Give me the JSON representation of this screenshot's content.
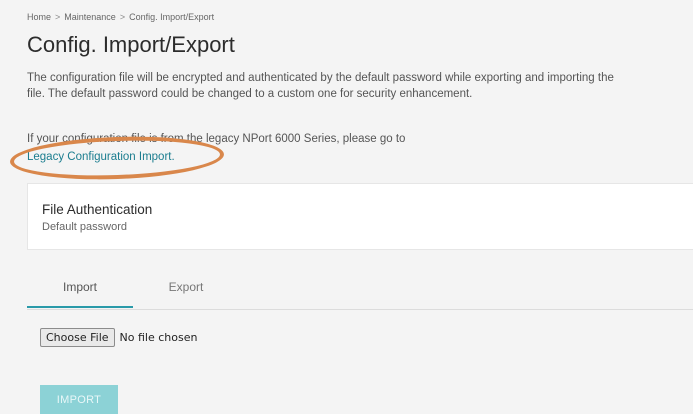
{
  "breadcrumb": {
    "items": [
      "Home",
      "Maintenance",
      "Config. Import/Export"
    ],
    "separator": ">"
  },
  "page": {
    "title": "Config. Import/Export",
    "description": "The configuration file will be encrypted and authenticated by the default password while exporting and importing the file. The default password could be changed to a custom one for security enhancement.",
    "legacy_text": "If your configuration file is from the legacy NPort 6000 Series, please go to",
    "legacy_link": "Legacy Configuration Import."
  },
  "auth_card": {
    "title": "File Authentication",
    "subtitle": "Default password"
  },
  "tabs": [
    {
      "label": "Import",
      "active": true
    },
    {
      "label": "Export",
      "active": false
    }
  ],
  "file_input": {
    "button_label": "Choose File",
    "status": "No file chosen"
  },
  "actions": {
    "import_label": "IMPORT"
  },
  "colors": {
    "accent": "#2a9aa9",
    "link": "#1b7d8f",
    "highlight": "#d9874b",
    "import_button_disabled": "#8cd2d6"
  }
}
